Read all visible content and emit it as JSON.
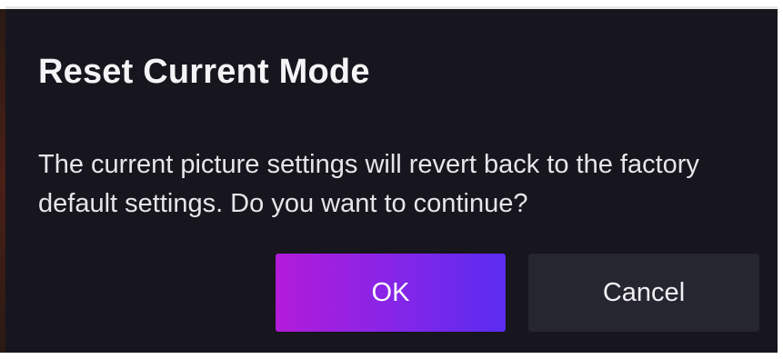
{
  "dialog": {
    "title": "Reset Current Mode",
    "message": "The current picture settings will revert back to the factory default settings. Do you want to continue?",
    "buttons": {
      "ok_label": "OK",
      "cancel_label": "Cancel"
    }
  },
  "colors": {
    "dialog_background": "#17151d",
    "ok_gradient_start": "#b21bd9",
    "ok_gradient_end": "#5a2cf0",
    "cancel_background": "#252630",
    "text": "#f4f4f6"
  }
}
